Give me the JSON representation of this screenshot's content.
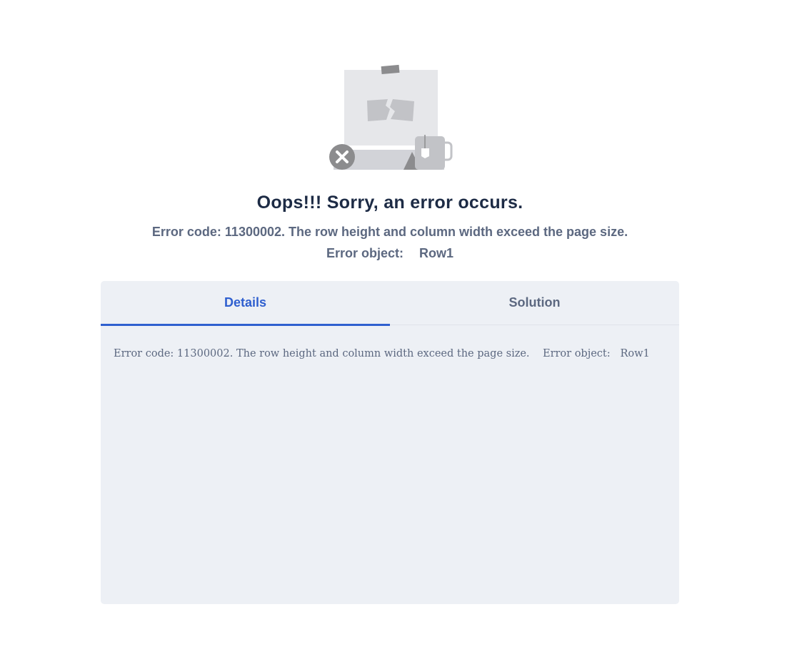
{
  "error": {
    "title": "Oops!!! Sorry, an error occurs.",
    "code_message": "Error code: 11300002. The row height and column width exceed the page size.",
    "object_label": "Error object:",
    "object_value": "Row1"
  },
  "tabs": {
    "details_label": "Details",
    "solution_label": "Solution",
    "active": "Details"
  },
  "details": {
    "text": "Error code: 11300002. The row height and column width exceed the page size.    Error object:   Row1"
  },
  "colors": {
    "accent": "#2f5fcf",
    "title": "#1d2b45",
    "muted": "#5c6880",
    "panel_bg": "#edf0f5"
  },
  "icons": {
    "illustration": "broken-picture-illustration",
    "error_badge": "close-circle-icon",
    "mug": "tea-mug-icon"
  }
}
